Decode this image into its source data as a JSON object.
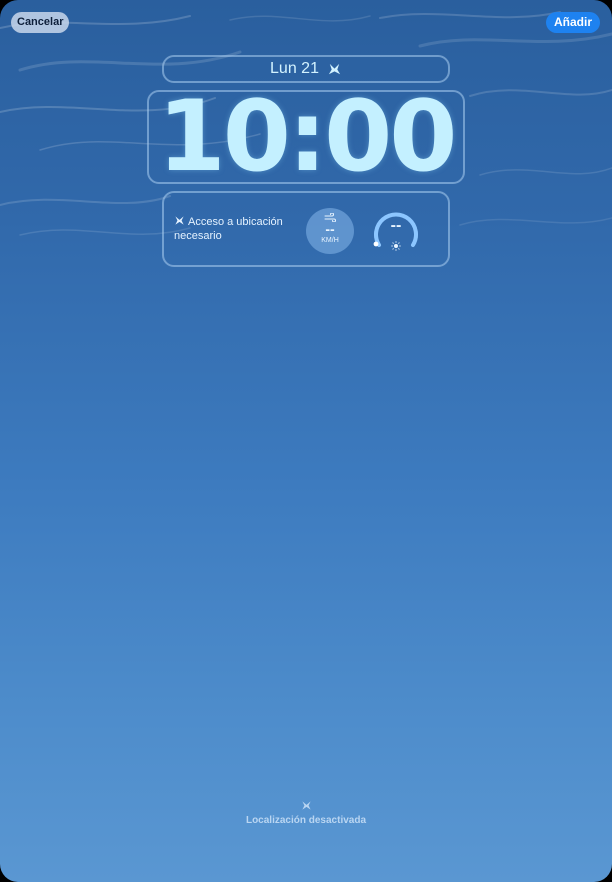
{
  "header": {
    "cancel_label": "Cancelar",
    "add_label": "Añadir"
  },
  "lock_screen": {
    "date": "Lun 21",
    "time": "10:00"
  },
  "widgets": {
    "location_text": "Acceso a ubicación necesario",
    "wind_value": "--",
    "wind_unit": "KM/H",
    "uv_value": "--"
  },
  "footer": {
    "status_text": "Localización desactivada"
  },
  "icons": {
    "date_complication": "bird-icon",
    "location": "location-arrow-icon",
    "wind": "wind-icon",
    "uv": "sun-icon",
    "footer": "location-arrow-icon"
  },
  "colors": {
    "add_button": "#1e82f0",
    "time_text": "#c4f0ff"
  }
}
